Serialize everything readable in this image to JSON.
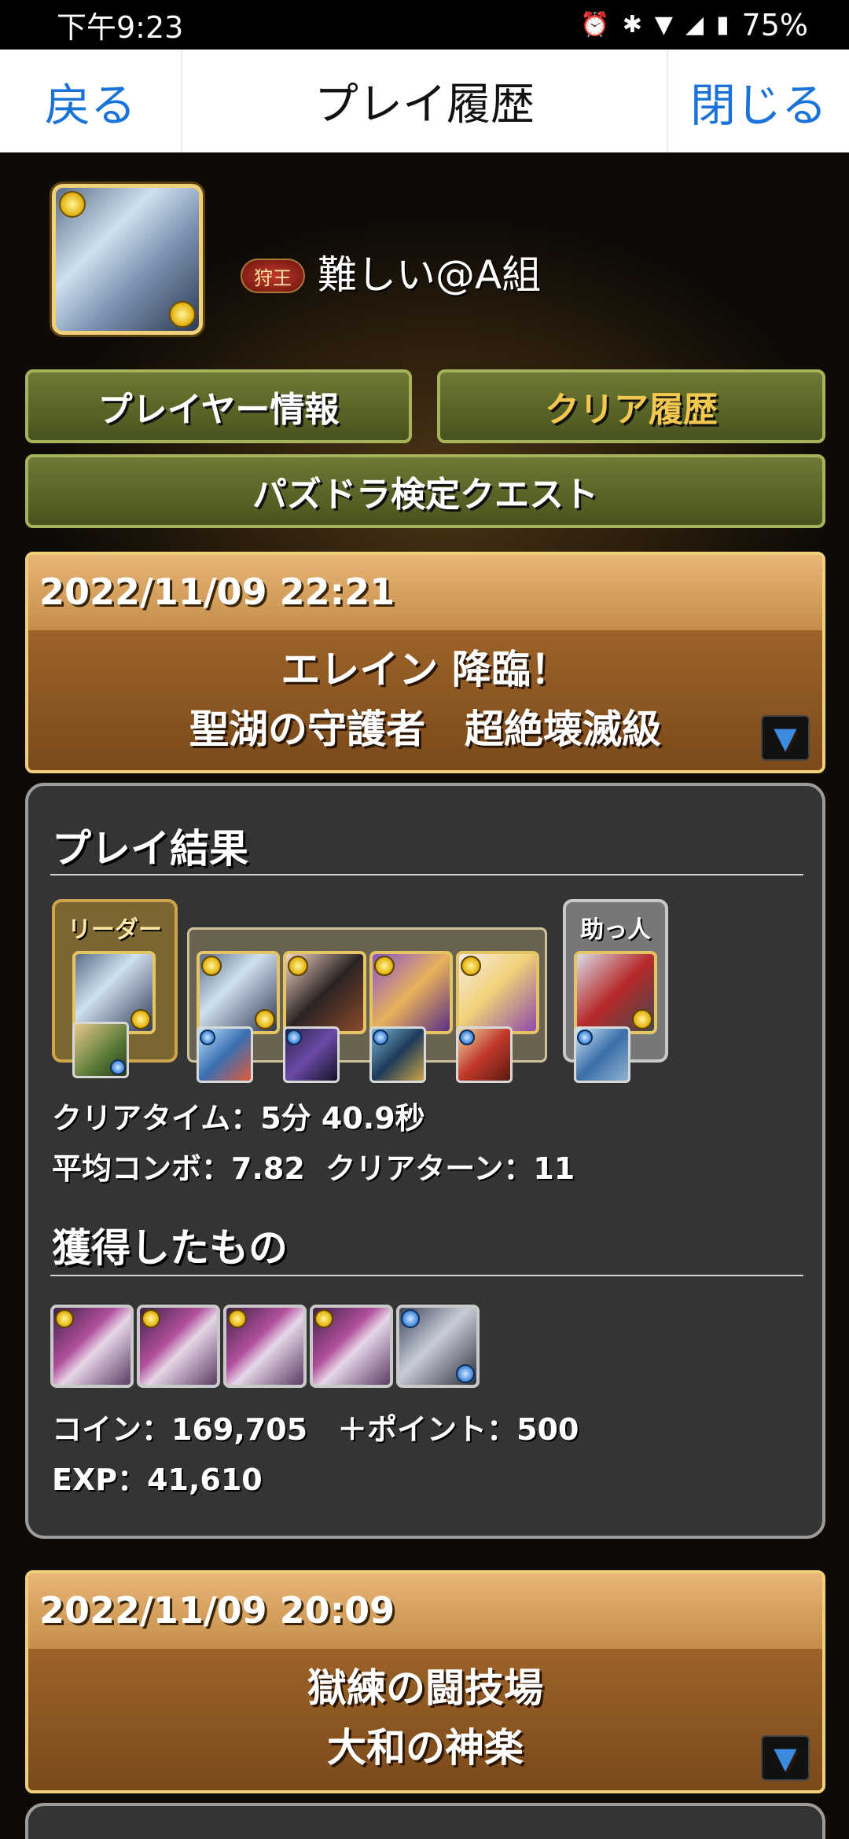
{
  "status_bar": {
    "time": "下午9:23",
    "battery": "75%"
  },
  "nav": {
    "back_label": "戻る",
    "title": "プレイ履歴",
    "close_label": "閉じる"
  },
  "profile": {
    "rank_badge": "狩王",
    "username": "難しい@A組"
  },
  "tabs": {
    "player_info": "プレイヤー情報",
    "clear_history": "クリア履歴",
    "exam_quest": "パズドラ検定クエスト"
  },
  "quests": [
    {
      "datetime": "2022/11/09 22:21",
      "line1": "エレイン 降臨！",
      "line2": "聖湖の守護者　超絶壊滅級"
    },
    {
      "datetime": "2022/11/09 20:09",
      "line1": "獄練の闘技場",
      "line2": "大和の神楽"
    }
  ],
  "result": {
    "title": "プレイ結果",
    "leader_label": "リーダー",
    "helper_label": "助っ人",
    "clear_time": "クリアタイム：5分 40.9秒",
    "combo_and_turns": "平均コンボ：7.82  クリアターン：11",
    "rewards_title": "獲得したもの",
    "coin_and_points": "コイン：169,705　＋ポイント：500",
    "exp": "EXP：41,610"
  },
  "colors": {
    "accent_blue": "#1a73d8",
    "gold": "#f2c850",
    "panel": "#343434"
  }
}
